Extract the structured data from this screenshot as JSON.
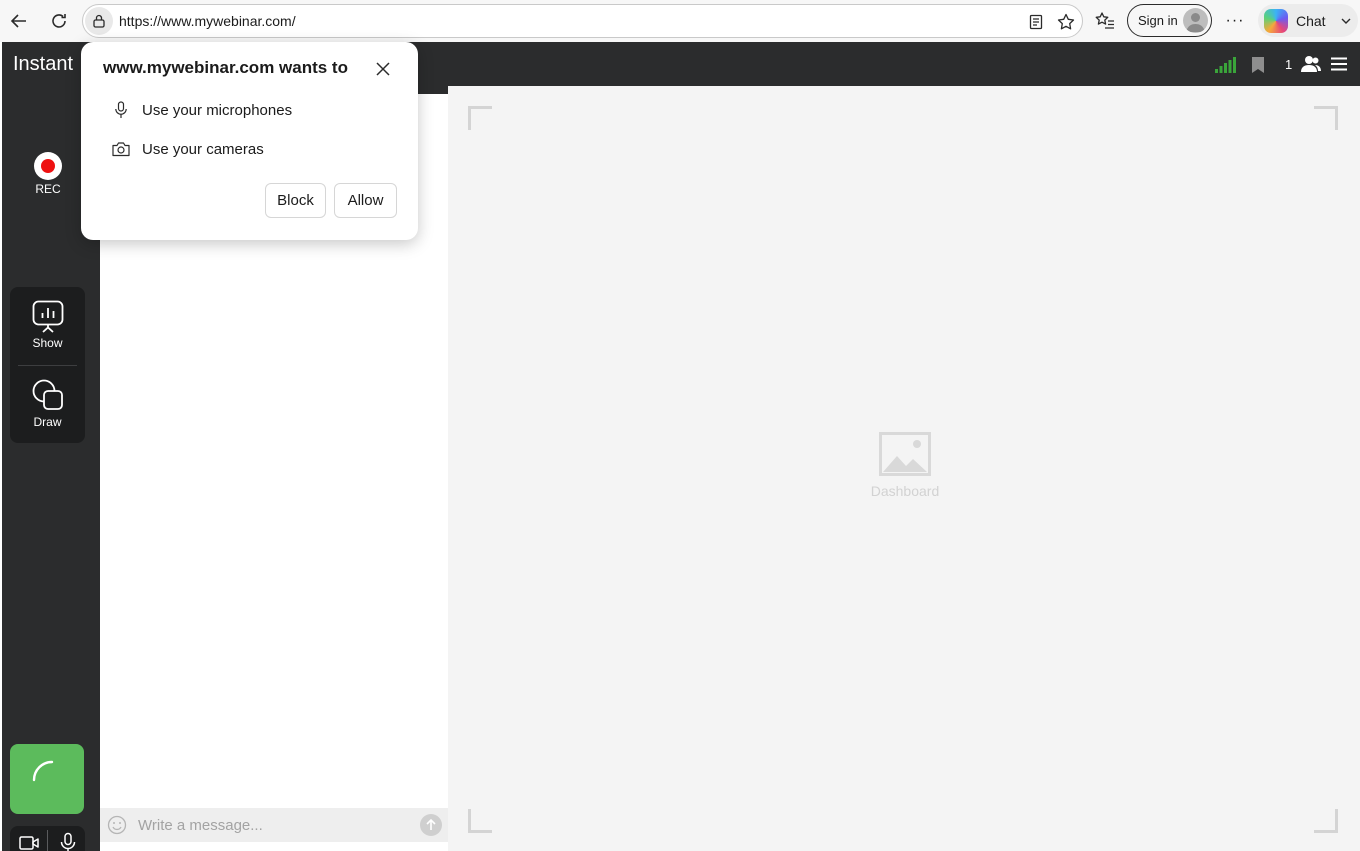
{
  "browser": {
    "url": "https://www.mywebinar.com/",
    "signin_label": "Sign in",
    "more_label": "···",
    "chat_label": "Chat"
  },
  "app": {
    "brand": "Instant",
    "participants_count": "1",
    "rec_label": "REC",
    "tools": [
      {
        "label": "Show"
      },
      {
        "label": "Draw"
      }
    ],
    "chat": {
      "placeholder": "Write a message..."
    },
    "stage": {
      "placeholder_label": "Dashboard"
    },
    "colors": {
      "sidebar_bg": "#2b2c2d",
      "go_button": "#5cbb5c",
      "rec_dot": "#ee1111",
      "signal": "#3aa53a"
    }
  },
  "permission_popup": {
    "title": "www.mywebinar.com wants to",
    "permissions": [
      {
        "label": "Use your microphones",
        "icon": "microphone-icon"
      },
      {
        "label": "Use your cameras",
        "icon": "camera-icon"
      }
    ],
    "block_label": "Block",
    "allow_label": "Allow"
  }
}
